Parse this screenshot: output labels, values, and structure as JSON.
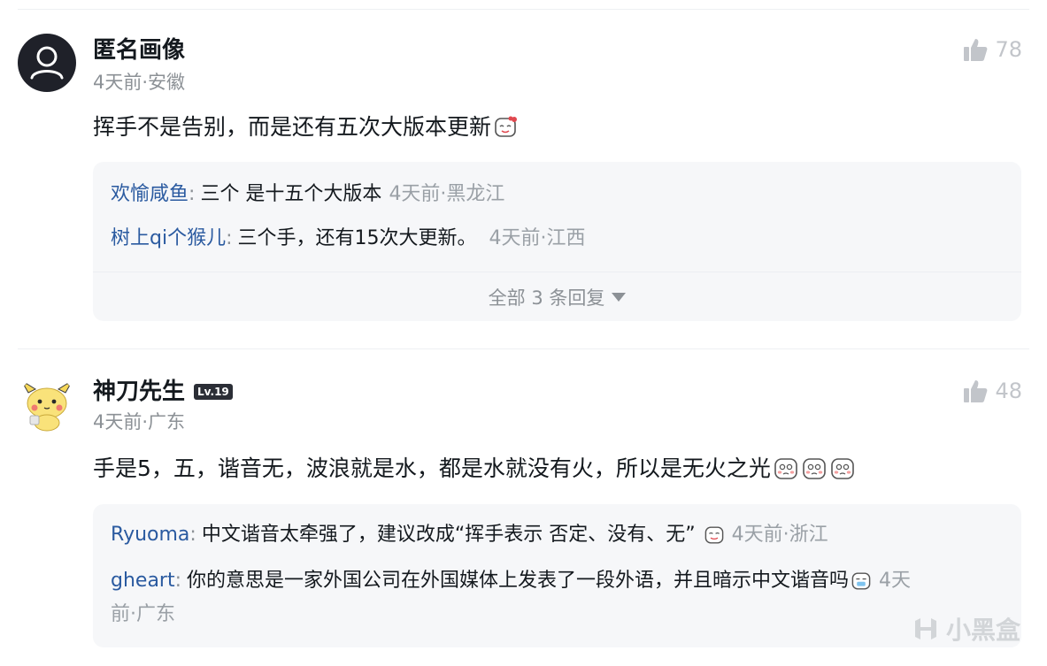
{
  "comments": [
    {
      "username": "匿名画像",
      "meta": "4天前·安徽",
      "likes": "78",
      "text": "挥手不是告别，而是还有五次大版本更新",
      "replies": [
        {
          "name": "欢愉咸鱼",
          "colon": ":",
          "text": "三个 是十五个大版本",
          "time": "4天前·黑龙江"
        },
        {
          "name": "树上qi个猴儿",
          "colon": ":",
          "text": "三个手，还有15次大更新。",
          "time": "4天前·江西"
        }
      ],
      "more_replies": "全部 3 条回复"
    },
    {
      "username": "神刀先生",
      "level": "Lv.19",
      "meta": "4天前·广东",
      "likes": "48",
      "text": "手是5，五，谐音无，波浪就是水，都是水就没有火，所以是无火之光",
      "replies": [
        {
          "name": "Ryuoma",
          "colon": ":",
          "text": "中文谐音太牵强了，建议改成“挥手表示 否定、没有、无”",
          "time": "4天前·浙江"
        },
        {
          "name": "gheart",
          "colon": ":",
          "text": "你的意思是一家外国公司在外国媒体上发表了一段外语，并且暗示中文谐音吗",
          "time_a": "4天",
          "time_b": "前·广东"
        }
      ]
    }
  ],
  "watermark": "小黑盒",
  "icons": {
    "like": "thumbs-up-icon",
    "avatar_anon": "user-silhouette-icon",
    "avatar_pika": "pikachu-avatar-icon",
    "more": "caret-down-icon",
    "watermark_logo": "heybox-logo-icon"
  },
  "colors": {
    "reply_name": "#2a5aa0",
    "meta": "#8c9196",
    "reply_bg": "#f6f7f9"
  }
}
